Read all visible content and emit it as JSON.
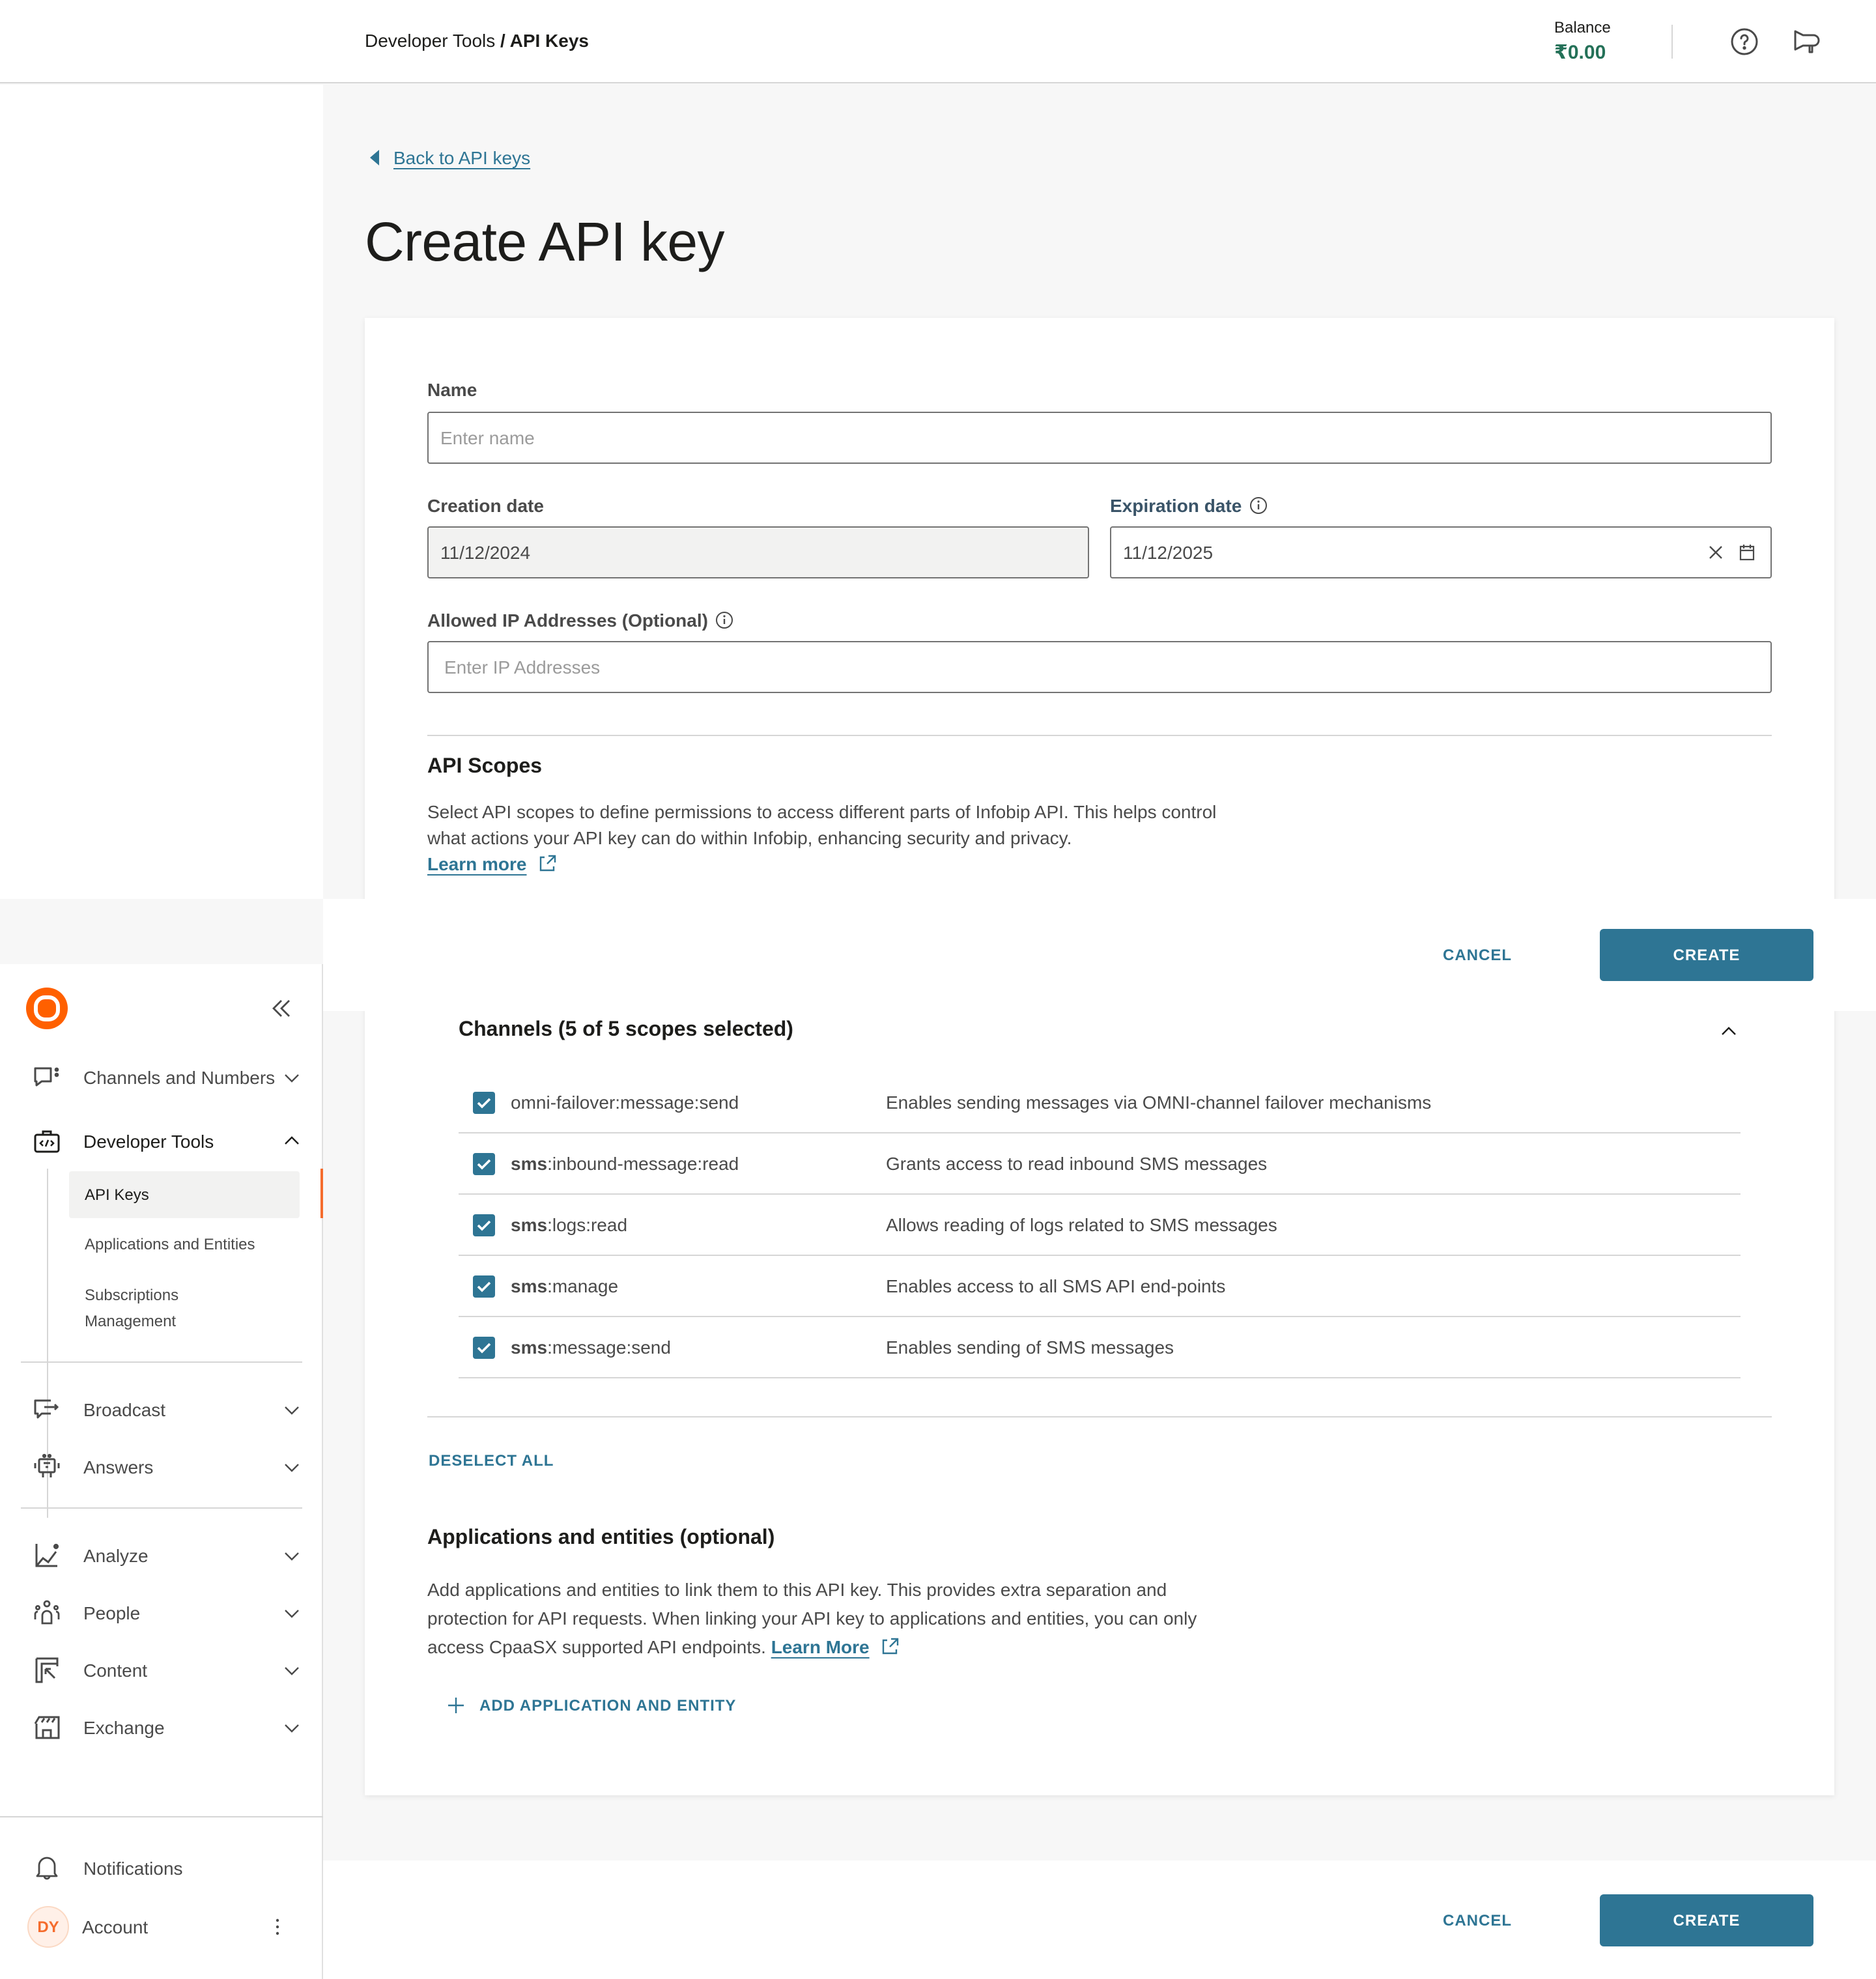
{
  "header": {
    "breadcrumb_parent": "Developer Tools",
    "breadcrumb_separator": " / ",
    "breadcrumb_current": "API Keys",
    "balance_label": "Balance",
    "balance_value": "₹0.00",
    "balance_color": "#247158",
    "icons": [
      "help-icon",
      "megaphone-icon"
    ]
  },
  "page": {
    "back_link": "Back to API keys",
    "title": "Create API key"
  },
  "form": {
    "name": {
      "label": "Name",
      "value": "",
      "placeholder": "Enter name"
    },
    "creation_date": {
      "label": "Creation date",
      "value": "11/12/2024",
      "disabled": true
    },
    "expiration_date": {
      "label": "Expiration date",
      "value": "11/12/2025"
    },
    "allowed_ip": {
      "label": "Allowed IP Addresses (Optional)",
      "value": "",
      "placeholder": "Enter IP Addresses"
    }
  },
  "api_scopes": {
    "title": "API Scopes",
    "description": "Select API scopes to define permissions to access different parts of Infobip API. This helps control what actions your API key can do within Infobip, enhancing security and privacy.",
    "learn_more": "Learn more",
    "group": {
      "title": "Channels (5 of 5 scopes selected)",
      "expanded": true,
      "scopes": [
        {
          "prefix": "",
          "name": "omni-failover:message:send",
          "description": "Enables sending messages via OMNI-channel failover mechanisms",
          "checked": true
        },
        {
          "prefix": "sms",
          "name": ":inbound-message:read",
          "description": "Grants access to read inbound SMS messages",
          "checked": true
        },
        {
          "prefix": "sms",
          "name": ":logs:read",
          "description": "Allows reading of logs related to SMS messages",
          "checked": true
        },
        {
          "prefix": "sms",
          "name": ":manage",
          "description": "Enables access to all SMS API end-points",
          "checked": true
        },
        {
          "prefix": "sms",
          "name": ":message:send",
          "description": "Enables sending of SMS messages",
          "checked": true
        }
      ]
    },
    "deselect_all": "DESELECT ALL"
  },
  "applications": {
    "title": "Applications and entities (optional)",
    "description": "Add applications and entities to link them to this API key. This provides extra separation and protection for API requests. When linking your API key to applications and entities, you can only access CpaaSX supported API endpoints.",
    "learn_more": "Learn More",
    "add_button": "ADD APPLICATION AND ENTITY"
  },
  "actions": {
    "cancel": "CANCEL",
    "create": "CREATE",
    "primary_color": "#2e7594"
  },
  "sidebar": {
    "brand_color": "#ff6000",
    "nav": [
      {
        "label": "Channels and Numbers",
        "icon": "chat-icon",
        "expanded": false
      },
      {
        "label": "Developer Tools",
        "icon": "developer-toolbox-icon",
        "expanded": true,
        "children": [
          {
            "label": "API Keys",
            "active": true
          },
          {
            "label": "Applications and Entities",
            "active": false
          },
          {
            "label": "Subscriptions Management",
            "active": false
          }
        ]
      },
      {
        "label": "Broadcast",
        "icon": "broadcast-icon",
        "expanded": false
      },
      {
        "label": "Answers",
        "icon": "bot-icon",
        "expanded": false
      },
      {
        "label": "Analyze",
        "icon": "analytics-icon",
        "expanded": false
      },
      {
        "label": "People",
        "icon": "people-icon",
        "expanded": false
      },
      {
        "label": "Content",
        "icon": "content-icon",
        "expanded": false
      },
      {
        "label": "Exchange",
        "icon": "store-icon",
        "expanded": false
      }
    ],
    "notifications": "Notifications",
    "account": {
      "label": "Account",
      "initials": "DY"
    }
  }
}
